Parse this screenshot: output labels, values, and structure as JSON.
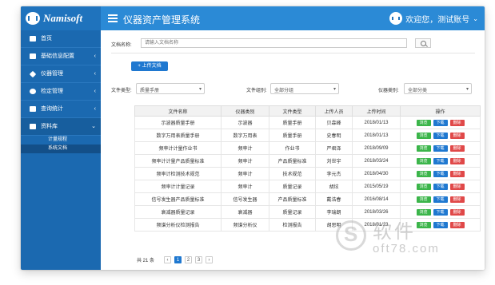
{
  "header": {
    "logo_text": "Namisoft",
    "title": "仪器资产管理系统",
    "user_text": "欢迎您，测试账号",
    "caret": "⌄"
  },
  "sidebar": {
    "items": [
      {
        "label": "首页",
        "chevron": ""
      },
      {
        "label": "基础信息配置",
        "chevron": "‹"
      },
      {
        "label": "仪器管理",
        "chevron": "‹"
      },
      {
        "label": "检定管理",
        "chevron": "‹"
      },
      {
        "label": "查询统计",
        "chevron": "‹"
      },
      {
        "label": "资料库",
        "chevron": "⌄"
      }
    ],
    "sub_items": [
      "计量规程",
      "系统文档"
    ]
  },
  "search": {
    "label": "文档名称:",
    "placeholder": "请输入文档名称"
  },
  "upload_label": "+ 上传文档",
  "filters": {
    "doc_type": {
      "label": "文件类型:",
      "value": "质量手册"
    },
    "doc_group": {
      "label": "文件组别:",
      "value": "全部分组"
    },
    "inst_type": {
      "label": "仪器类别:",
      "value": "全部分类"
    },
    "caret": "▾"
  },
  "table": {
    "headers": [
      "文件名称",
      "仪器类别",
      "文件类型",
      "上传人员",
      "上传时间",
      "操作"
    ],
    "rows": [
      [
        "示波器质量手册",
        "示波器",
        "质量手册",
        "贝森峰",
        "2018/01/13"
      ],
      [
        "数字万用表质量手册",
        "数字万用表",
        "质量手册",
        "史春明",
        "2018/01/13"
      ],
      [
        "频率计计量作业书",
        "频率计",
        "作业书",
        "严君泽",
        "2018/09/09"
      ],
      [
        "频率计计量产品质量标准",
        "频率计",
        "产品质量标准",
        "刘世宇",
        "2018/03/24"
      ],
      [
        "频率计检测技术规范",
        "频率计",
        "技术规范",
        "李元杰",
        "2018/04/30"
      ],
      [
        "频率计计量记录",
        "频率计",
        "质量记录",
        "胡炫",
        "2015/05/19"
      ],
      [
        "信号发生器产品质量标准",
        "信号发生器",
        "产品质量标准",
        "戴浩春",
        "2016/08/14"
      ],
      [
        "衰减器质量记录",
        "衰减器",
        "质量记录",
        "李瑞朗",
        "2018/03/26"
      ],
      [
        "频谱分析仪检测报告",
        "频谱分析仪",
        "检测报告",
        "胡思明",
        "2018/01/23"
      ]
    ],
    "ops": {
      "view": "浏览",
      "download": "下载",
      "delete": "删除"
    }
  },
  "pagination": {
    "total": "共 21 条",
    "prev": "‹",
    "pages": [
      "1",
      "2",
      "3"
    ],
    "next": "›",
    "current": "1"
  },
  "watermark": {
    "letter": "S",
    "text": "软件",
    "url": "oft78.com"
  },
  "colors": {
    "header": "#2b8ad6",
    "sidebar": "#1b69b0",
    "primary": "#1f78d0",
    "view": "#3bb54a",
    "delete": "#e04848"
  }
}
